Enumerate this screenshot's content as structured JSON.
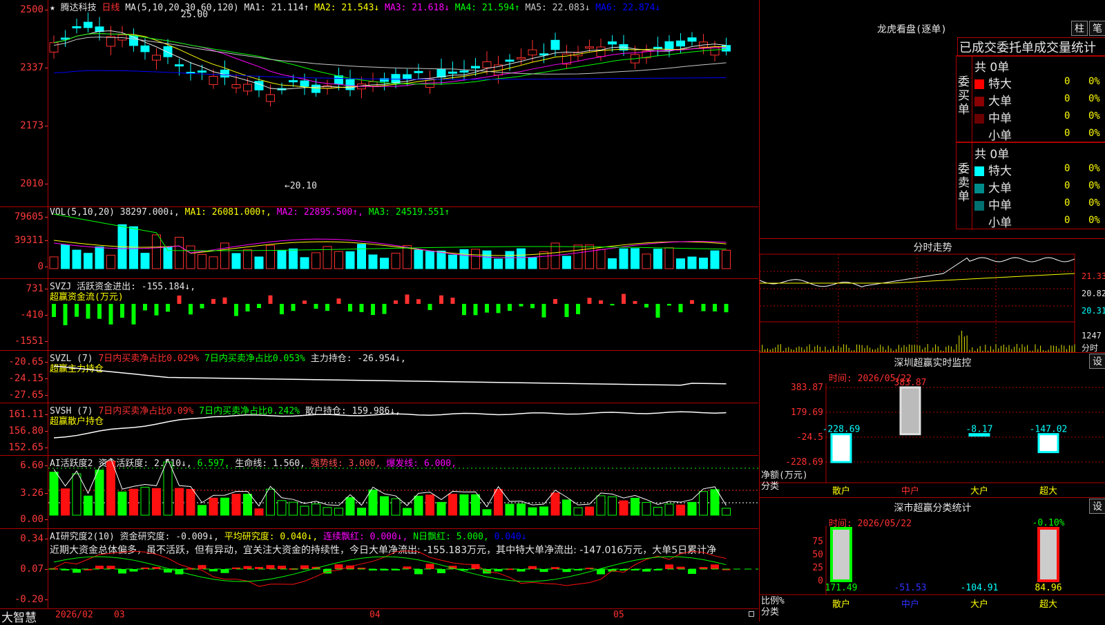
{
  "main": {
    "star": "★",
    "name": "腾达科技",
    "period": "日线",
    "ma_label": "MA(5,10,20,30,60,120)",
    "ma": [
      {
        "t": "MA1: 21.114↑",
        "color": "#e6e6e6"
      },
      {
        "t": "MA2: 21.543↓",
        "color": "#ffff00"
      },
      {
        "t": "MA3: 21.618↓",
        "color": "#ff00ff"
      },
      {
        "t": "MA4: 21.594↑",
        "color": "#00ff00"
      },
      {
        "t": "MA5: 22.083↓",
        "color": "#c8c8c8"
      },
      {
        "t": "MA6: 22.874↓",
        "color": "#0000ff"
      }
    ],
    "ticks": [
      "2500",
      "2337",
      "2173",
      "2010"
    ],
    "high_label": "25.00",
    "low_label": "←20.10"
  },
  "vol": {
    "label": "VOL(5,10,20)",
    "items": [
      {
        "t": "38297.000↓,",
        "color": "#e6e6e6"
      },
      {
        "t": "MA1: 26081.000↑,",
        "color": "#ffff00"
      },
      {
        "t": "MA2: 22895.500↑,",
        "color": "#ff00ff"
      },
      {
        "t": "MA3: 24519.551↑",
        "color": "#00ff00"
      }
    ],
    "ticks": [
      "79605",
      "39311",
      "0"
    ]
  },
  "svzj": {
    "label": "SVZJ  活跃资金进出: -155.184↓,",
    "sub": "超赢资金流(万元)",
    "ticks": [
      "731",
      "-410",
      "-1551"
    ]
  },
  "svzl": {
    "label": "SVZL (7)",
    "a": "7日内买卖净占比0.029%",
    "b": "7日内买卖净占比0.053%",
    "c": "主力持仓: -26.954↓,",
    "sub": "超赢主力持仓",
    "ticks": [
      "-20.65",
      "-24.15",
      "-27.65"
    ]
  },
  "svsh": {
    "label": "SVSH (7)",
    "a": "7日内买卖净占比0.09%",
    "b": "7日内买卖净占比0.242%",
    "c": "散户持仓: 159.986↓,",
    "sub": "超赢散户持仓",
    "ticks": [
      "161.11",
      "156.80",
      "152.65"
    ]
  },
  "ai1": {
    "label": "AI活跃度2",
    "a": "资金活跃度: 2.510↓,",
    "b": "6.597,",
    "c": "生命线: 1.560,",
    "d": "强势线: 3.000,",
    "e": "爆发线: 6.000,",
    "ticks": [
      "6.60",
      "3.26",
      "0.00"
    ]
  },
  "ai2": {
    "label": "AI研究度2(10)",
    "a": "资金研究度: -0.009↓,",
    "b": "平均研究度: 0.040↓,",
    "c": "连续飘红: 0.000↓,",
    "d": "N日飘红: 5.000,",
    "e": "0.040↓",
    "note": "近期大资金总体偏多，虽不活跃，但有异动，宜关注大资金的持续性，今日大单净流出: -155.183万元，其中特大单净流出: -147.016万元，大单5日累计净",
    "ticks": [
      "0.34",
      "0.07",
      "-0.20"
    ]
  },
  "xaxis": {
    "brand": "大智慧",
    "d1": "2026/02",
    "d2": "03",
    "d3": "04",
    "d4": "05"
  },
  "lhb": {
    "title": "龙虎看盘(逐单)",
    "btn1": "柱",
    "btn2": "笔",
    "sub": "已成交委托单成交量统计",
    "buy_side": "委买单",
    "sell_side": "委卖单",
    "buy_total": "共 0单",
    "sell_total": "共 0单",
    "buy_rows": [
      {
        "label": "特大",
        "v": "0",
        "p": "0%",
        "color": "#ff0000"
      },
      {
        "label": "大单",
        "v": "0",
        "p": "0%",
        "color": "#8b0000"
      },
      {
        "label": "中单",
        "v": "0",
        "p": "0%",
        "color": "#6b0000"
      },
      {
        "label": "小单",
        "v": "0",
        "p": "0%",
        "color": "#000000"
      }
    ],
    "sell_rows": [
      {
        "label": "特大",
        "v": "0",
        "p": "0%",
        "color": "#00ffff"
      },
      {
        "label": "大单",
        "v": "0",
        "p": "0%",
        "color": "#008b8b"
      },
      {
        "label": "中单",
        "v": "0",
        "p": "0%",
        "color": "#007070"
      },
      {
        "label": "小单",
        "v": "0",
        "p": "0%",
        "color": "#000000"
      }
    ]
  },
  "intraday": {
    "title": "分时走势",
    "ticks": [
      "21.33",
      "20.82",
      "20.31"
    ],
    "vol_tick": "1247",
    "vol_label": "分时"
  },
  "monitor": {
    "title": "深圳超赢实时监控",
    "btn": "设",
    "time": "时间: 2026/05/22",
    "ylabel": "净额(万元)",
    "xlabel": "分类",
    "ticks": [
      "383.87",
      "179.69",
      "-24.5",
      "-228.69"
    ],
    "cats": [
      "散户",
      "中户",
      "大户",
      "超大"
    ]
  },
  "chart_data": [
    {
      "type": "bar",
      "title": "深圳超赢实时监控",
      "xlabel": "分类",
      "ylabel": "净额(万元)",
      "categories": [
        "散户",
        "中户",
        "大户",
        "超大"
      ],
      "values": [
        -228.69,
        383.87,
        -8.17,
        -147.02
      ],
      "ylim": [
        -228.69,
        383.87
      ]
    },
    {
      "type": "bar",
      "title": "深市超赢分类统计",
      "xlabel": "分类",
      "ylabel": "比例%",
      "categories": [
        "散户",
        "中户",
        "大户",
        "超大"
      ],
      "values": [
        171.49,
        -51.53,
        -104.91,
        84.96
      ],
      "ylim": [
        0,
        100
      ],
      "extra_label": "-0.10%"
    }
  ],
  "classify": {
    "title": "深市超赢分类统计",
    "btn": "设",
    "time": "时间: 2026/05/22",
    "ylabel": "比例%",
    "xlabel": "分类",
    "ticks": [
      "75",
      "50",
      "25",
      "0"
    ],
    "cats": [
      "散户",
      "中户",
      "大户",
      "超大"
    ]
  }
}
